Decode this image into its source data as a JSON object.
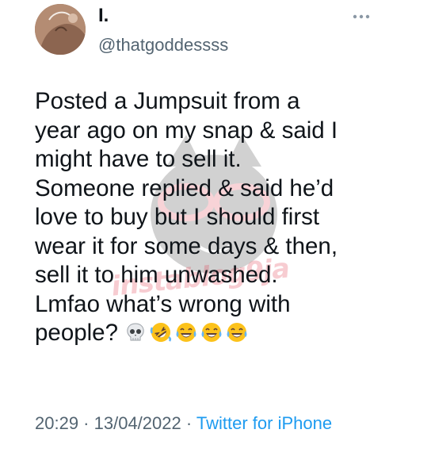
{
  "tweet": {
    "display_name": "I.",
    "handle": "@thatgoddessss",
    "text": "Posted a Jumpsuit from a\nyear ago on my snap & said I\nmight have to sell it.\nSomeone replied & said he’d\nlove to buy but I should first\nwear it for some days & then,\nsell it to him unwashed.\nLmfao what’s wrong with\npeople?",
    "emojis": [
      "skull-emoji",
      "rolling-on-floor-laughing-emoji",
      "tears-of-joy-emoji",
      "tears-of-joy-emoji",
      "tears-of-joy-emoji"
    ],
    "time": "20:29",
    "separator": " · ",
    "date": "13/04/2022",
    "source": "Twitter for iPhone"
  },
  "watermark": {
    "text": "instablog9ja"
  },
  "colors": {
    "text": "#0f1419",
    "secondary": "#536471",
    "link": "#1d9bf0",
    "watermark": "#e33a4c"
  }
}
